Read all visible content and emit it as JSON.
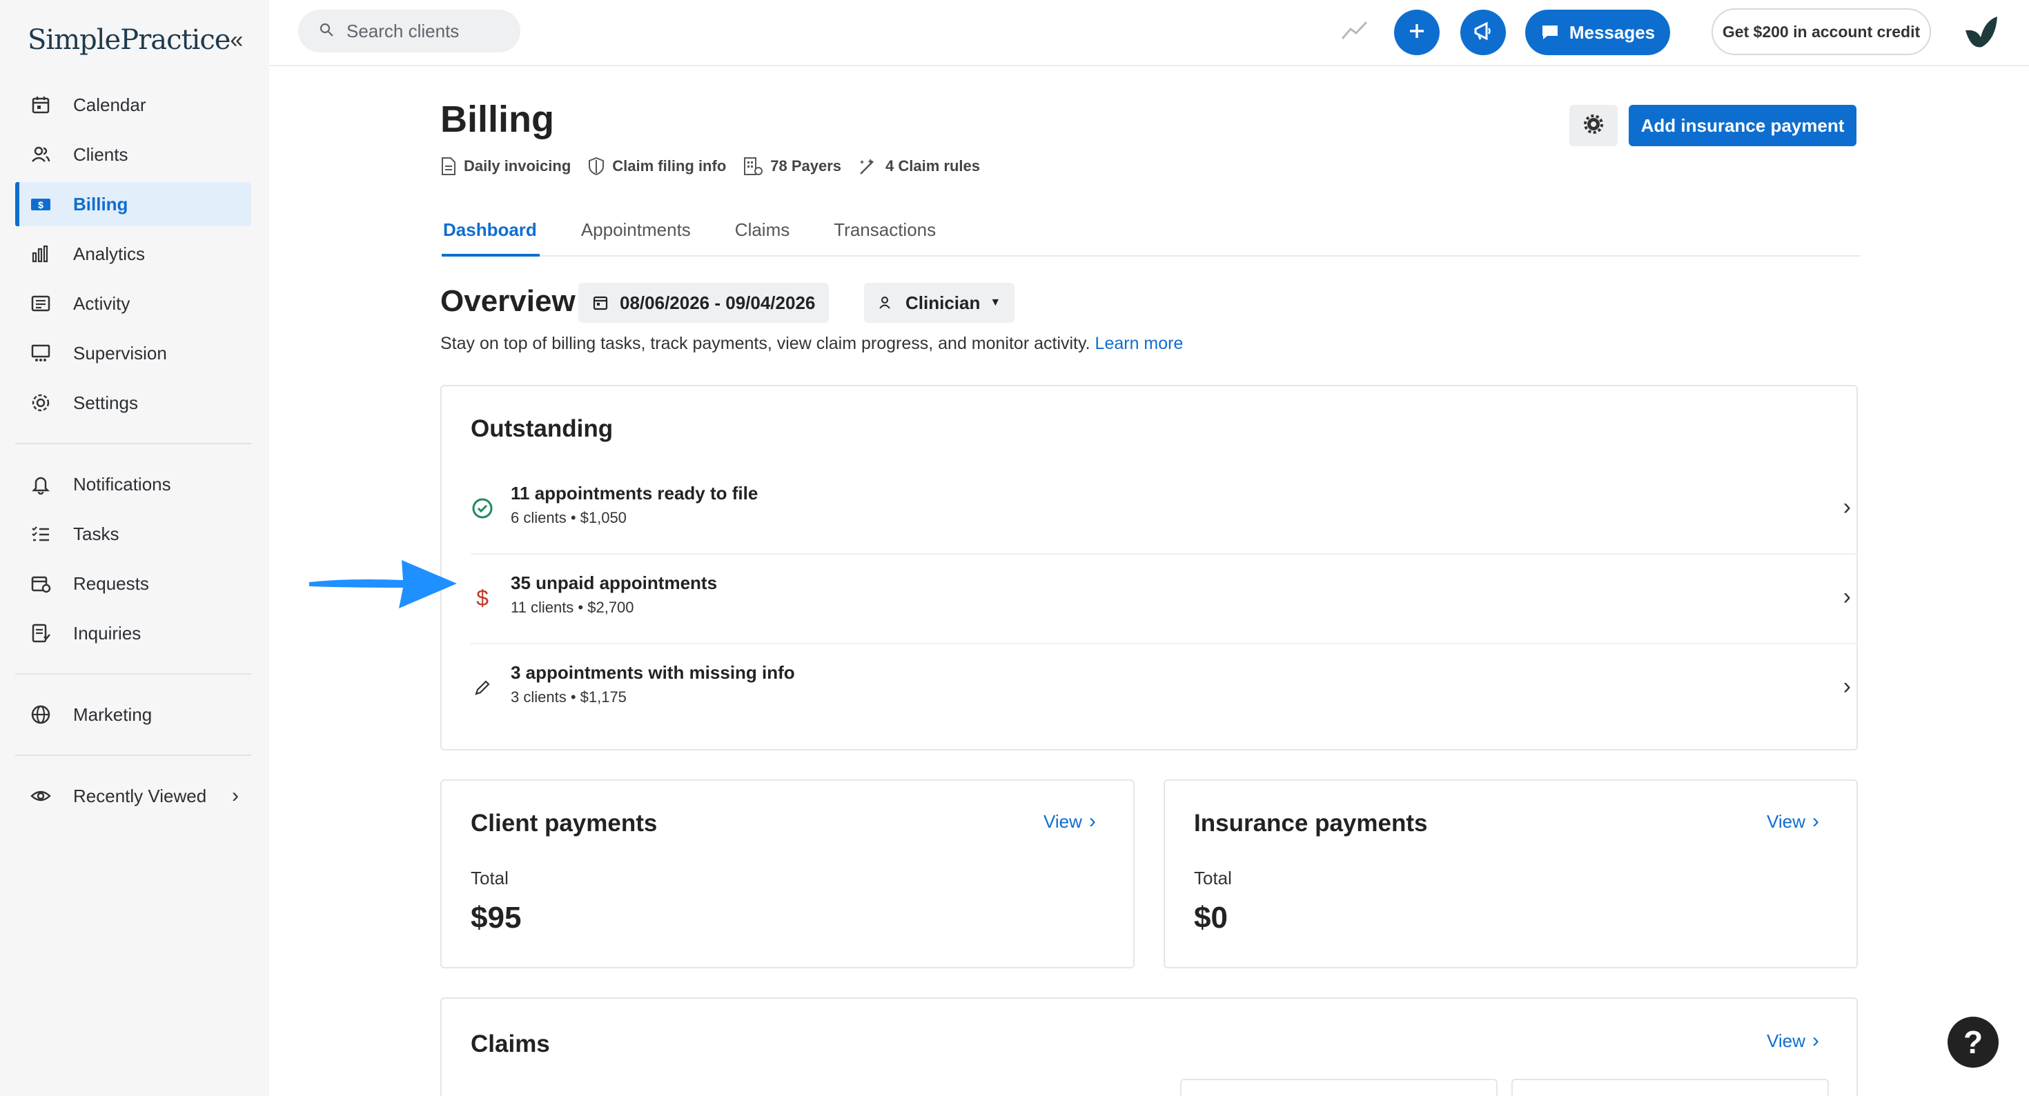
{
  "app": {
    "logo": "SimplePractice"
  },
  "sidebar": {
    "items": [
      {
        "label": "Calendar"
      },
      {
        "label": "Clients"
      },
      {
        "label": "Billing"
      },
      {
        "label": "Analytics"
      },
      {
        "label": "Activity"
      },
      {
        "label": "Supervision"
      },
      {
        "label": "Settings"
      },
      {
        "label": "Notifications"
      },
      {
        "label": "Tasks"
      },
      {
        "label": "Requests"
      },
      {
        "label": "Inquiries"
      },
      {
        "label": "Marketing"
      },
      {
        "label": "Recently Viewed"
      }
    ],
    "active": "Billing"
  },
  "topbar": {
    "search_placeholder": "Search clients",
    "messages_label": "Messages",
    "credit_label": "Get $200 in account credit"
  },
  "page": {
    "title": "Billing",
    "sublinks": {
      "daily_invoicing": "Daily invoicing",
      "claim_filing": "Claim filing info",
      "payers": "78 Payers",
      "claim_rules": "4 Claim rules"
    },
    "add_payment_label": "Add insurance payment",
    "tabs": [
      {
        "label": "Dashboard"
      },
      {
        "label": "Appointments"
      },
      {
        "label": "Claims"
      },
      {
        "label": "Transactions"
      }
    ],
    "active_tab": "Dashboard"
  },
  "overview": {
    "title": "Overview",
    "date_range": "08/06/2026 - 09/04/2026",
    "clinician_label": "Clinician",
    "description": "Stay on top of billing tasks, track payments, view claim progress, and monitor activity.",
    "learn_more": "Learn more"
  },
  "outstanding": {
    "title": "Outstanding",
    "rows": [
      {
        "main": "11 appointments ready to file",
        "sub": "6 clients • $1,050"
      },
      {
        "main": "35 unpaid appointments",
        "sub": "11 clients • $2,700"
      },
      {
        "main": "3 appointments with missing info",
        "sub": "3 clients • $1,175"
      }
    ]
  },
  "client_payments": {
    "title": "Client payments",
    "view": "View",
    "total_label": "Total",
    "total": "$95"
  },
  "insurance_payments": {
    "title": "Insurance payments",
    "view": "View",
    "total_label": "Total",
    "total": "$0"
  },
  "claims": {
    "title": "Claims",
    "view": "View"
  },
  "help": {
    "label": "?"
  },
  "colors": {
    "accent": "#0e6ecf",
    "sidebar_bg": "#f6f6f7",
    "success": "#1e8a5a",
    "danger": "#c0392b",
    "annotation_arrow": "#1e90ff"
  }
}
